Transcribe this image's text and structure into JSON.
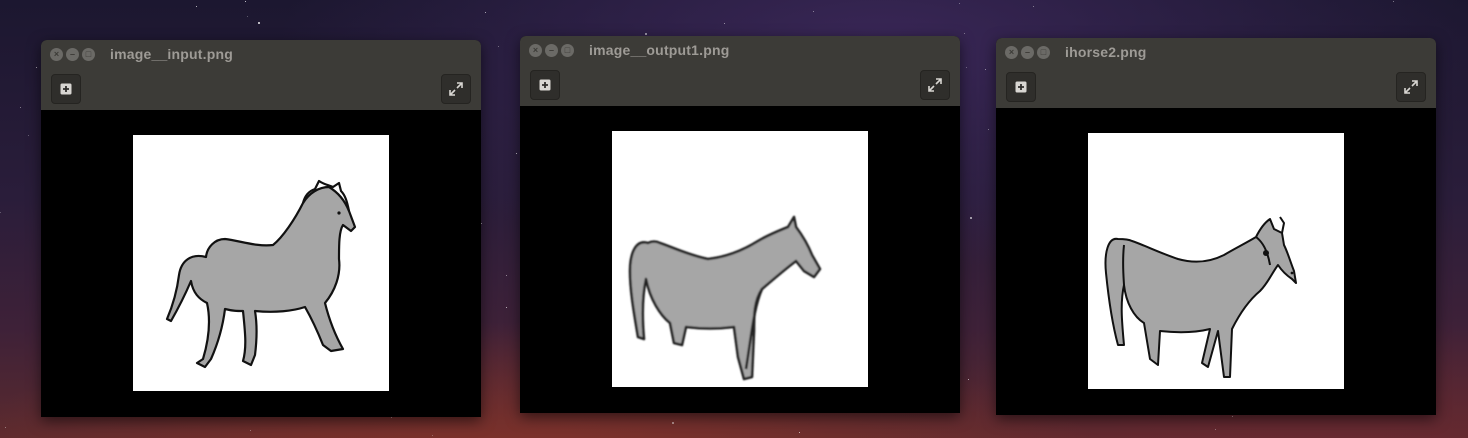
{
  "desktop": {
    "name": "desktop-background"
  },
  "windows": [
    {
      "title": "image__input.png",
      "close_glyph": "×",
      "minimize_glyph": "–",
      "maximize_glyph": "□",
      "add_icon": "plus-square-icon",
      "expand_icon": "expand-icon",
      "image": "horse-drawing-gray"
    },
    {
      "title": "image__output1.png",
      "close_glyph": "×",
      "minimize_glyph": "–",
      "maximize_glyph": "□",
      "add_icon": "plus-square-icon",
      "expand_icon": "expand-icon",
      "image": "horse-drawing-gray-blurred"
    },
    {
      "title": "ihorse2.png",
      "close_glyph": "×",
      "minimize_glyph": "–",
      "maximize_glyph": "□",
      "add_icon": "plus-square-icon",
      "expand_icon": "expand-icon",
      "image": "horse-drawing-gray-standing"
    }
  ],
  "colors": {
    "titlebar": "#3c3b37",
    "title_text": "#9e9b96",
    "horse_fill": "#a6a6a6",
    "horse_outline": "#111111"
  }
}
